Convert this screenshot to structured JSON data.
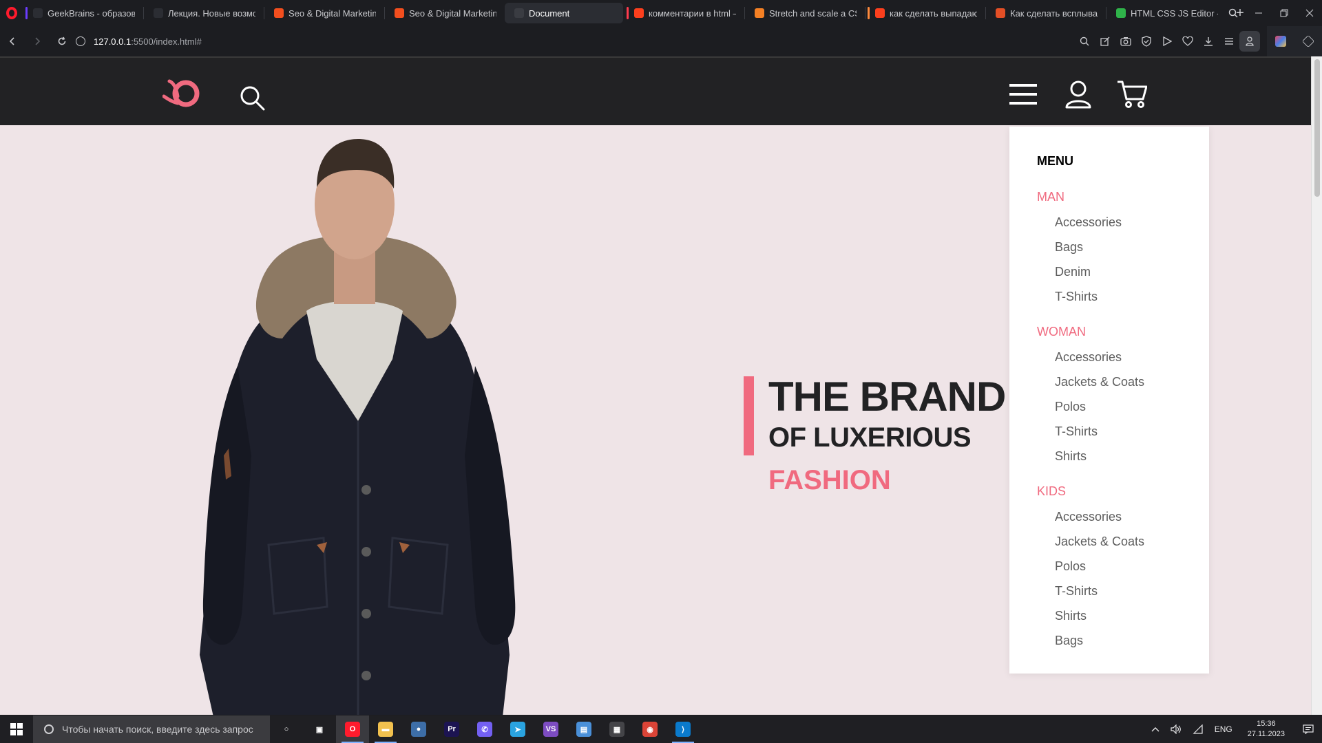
{
  "browser": {
    "tabs": [
      {
        "title": "GeekBrains - образовательный",
        "icon": "geekbrains-icon",
        "icon_color": "#2b2d33",
        "marker_color": "#6b3cff",
        "active": false
      },
      {
        "title": "Лекция. Новые возможности",
        "icon": "geekbrains-icon",
        "icon_color": "#2b2d33",
        "marker_color": "",
        "active": false
      },
      {
        "title": "Seo & Digital Marketing",
        "icon": "figma-icon",
        "icon_color": "#f24e1e",
        "marker_color": "",
        "active": false
      },
      {
        "title": "Seo & Digital Marketing",
        "icon": "figma-icon",
        "icon_color": "#f24e1e",
        "marker_color": "",
        "active": false
      },
      {
        "title": "Document",
        "icon": "globe-icon",
        "icon_color": "#3a3c42",
        "marker_color": "",
        "active": true
      },
      {
        "title": "комментарии в html —",
        "icon": "yandex-icon",
        "icon_color": "#fc3f1d",
        "marker_color": "#ff3b4e",
        "active": false
      },
      {
        "title": "Stretch and scale a CSS image",
        "icon": "stackoverflow-icon",
        "icon_color": "#f48024",
        "marker_color": "",
        "active": false
      },
      {
        "title": "как сделать выпадающее",
        "icon": "yandex-icon",
        "icon_color": "#fc3f1d",
        "marker_color": "#ff8a3d",
        "active": false
      },
      {
        "title": "Как сделать всплывающее",
        "icon": "html5-icon",
        "icon_color": "#e34f26",
        "marker_color": "",
        "active": false
      },
      {
        "title": "HTML CSS JS Editor - xtml",
        "icon": "check-icon",
        "icon_color": "#2fb34a",
        "marker_color": "",
        "active": false
      }
    ],
    "url": {
      "host": "127.0.0.1",
      "path": ":5500/index.html#"
    }
  },
  "site": {
    "headline": {
      "line1": "THE BRAND",
      "line2": "OF LUXERIOUS",
      "line3": "FASHION"
    },
    "menu": {
      "title": "MENU",
      "sections": [
        {
          "label": "MAN",
          "items": [
            "Accessories",
            "Bags",
            "Denim",
            "T-Shirts"
          ]
        },
        {
          "label": "WOMAN",
          "items": [
            "Accessories",
            "Jackets & Coats",
            "Polos",
            "T-Shirts",
            "Shirts"
          ]
        },
        {
          "label": "KIDS",
          "items": [
            "Accessories",
            "Jackets & Coats",
            "Polos",
            "T-Shirts",
            "Shirts",
            "Bags"
          ]
        }
      ]
    },
    "colors": {
      "accent": "#f06a7f",
      "header_bg": "#222224",
      "hero_bg": "#efe4e7"
    }
  },
  "taskbar": {
    "search_placeholder": "Чтобы начать поиск, введите здесь запрос",
    "apps": [
      {
        "name": "cortana-icon",
        "glyph": "○",
        "color": "transparent",
        "running": false,
        "active": false
      },
      {
        "name": "task-view-icon",
        "glyph": "▣",
        "color": "transparent",
        "running": false,
        "active": false
      },
      {
        "name": "opera-app-icon",
        "glyph": "O",
        "color": "#ff1b2d",
        "running": true,
        "active": true
      },
      {
        "name": "file-explorer-icon",
        "glyph": "▬",
        "color": "#f2c14e",
        "running": true,
        "active": false
      },
      {
        "name": "blender-icon",
        "glyph": "●",
        "color": "#3d6ea8",
        "running": false,
        "active": false
      },
      {
        "name": "premiere-icon",
        "glyph": "Pr",
        "color": "#1c1452",
        "running": false,
        "active": false
      },
      {
        "name": "viber-icon",
        "glyph": "✆",
        "color": "#7360f2",
        "running": false,
        "active": false
      },
      {
        "name": "telegram-icon",
        "glyph": "➤",
        "color": "#2aa3e0",
        "running": false,
        "active": false
      },
      {
        "name": "visual-studio-icon",
        "glyph": "VS",
        "color": "#7d4cc2",
        "running": false,
        "active": false
      },
      {
        "name": "installer-icon",
        "glyph": "▤",
        "color": "#4a90d9",
        "running": false,
        "active": false
      },
      {
        "name": "calculator-icon",
        "glyph": "▦",
        "color": "#444448",
        "running": false,
        "active": false
      },
      {
        "name": "chrome-icon",
        "glyph": "◉",
        "color": "#db4437",
        "running": false,
        "active": false
      },
      {
        "name": "vscode-icon",
        "glyph": "⟩",
        "color": "#0a7acc",
        "running": true,
        "active": false
      }
    ],
    "tray": {
      "language": "ENG",
      "time": "15:36",
      "date": "27.11.2023"
    }
  }
}
